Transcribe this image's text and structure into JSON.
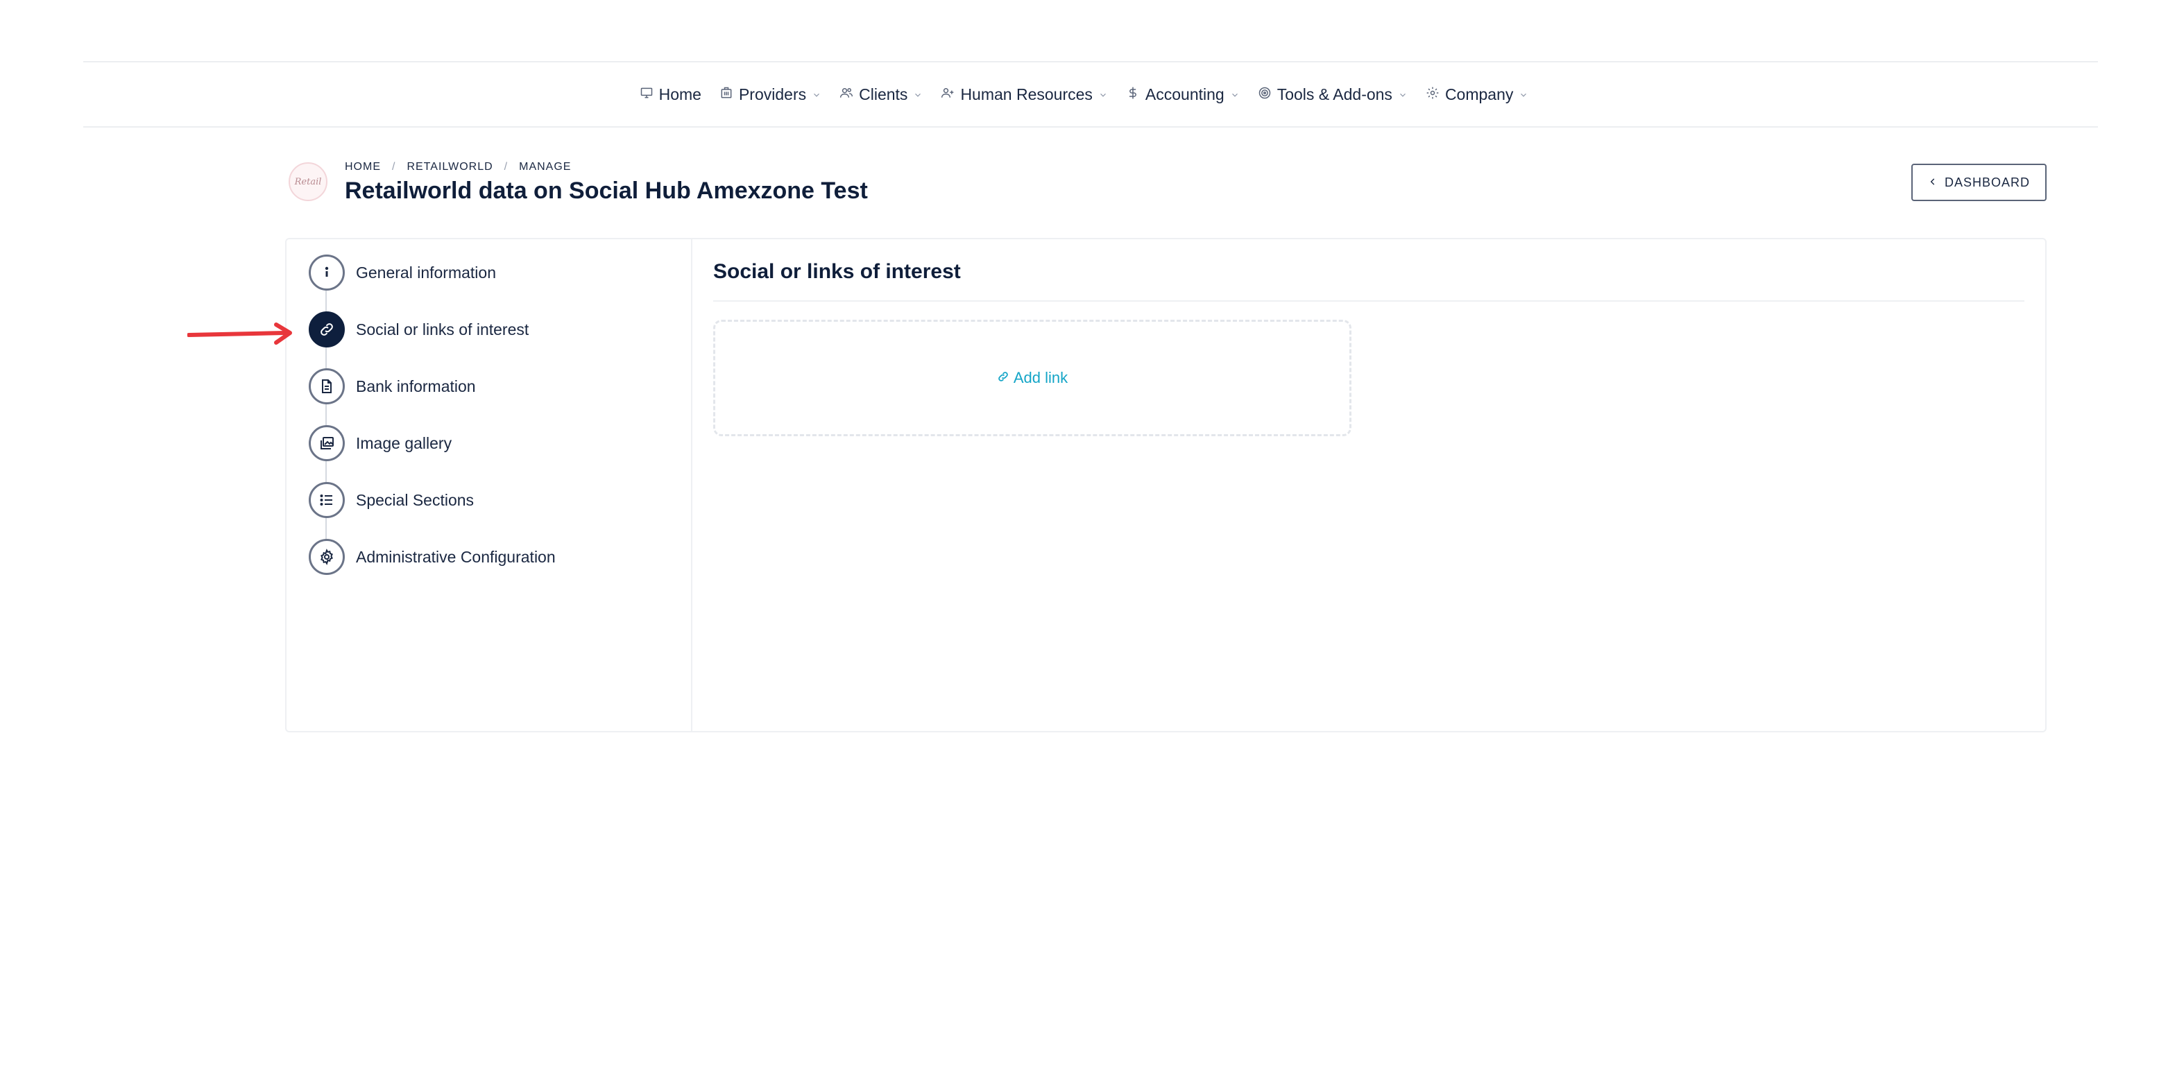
{
  "nav": {
    "items": [
      {
        "label": "Home",
        "icon": "monitor-icon",
        "dropdown": false
      },
      {
        "label": "Providers",
        "icon": "building-icon",
        "dropdown": true
      },
      {
        "label": "Clients",
        "icon": "users-icon",
        "dropdown": true
      },
      {
        "label": "Human Resources",
        "icon": "user-plus-icon",
        "dropdown": true
      },
      {
        "label": "Accounting",
        "icon": "dollar-icon",
        "dropdown": true
      },
      {
        "label": "Tools & Add-ons",
        "icon": "target-icon",
        "dropdown": true
      },
      {
        "label": "Company",
        "icon": "gear-icon",
        "dropdown": true
      }
    ]
  },
  "header": {
    "breadcrumb": [
      "HOME",
      "RETAILWORLD",
      "MANAGE"
    ],
    "title": "Retailworld data on Social Hub Amexzone Test",
    "dashboard_button": "DASHBOARD"
  },
  "sidebar": {
    "steps": [
      {
        "label": "General information",
        "icon": "info-icon",
        "active": false
      },
      {
        "label": "Social or links of interest",
        "icon": "link-icon",
        "active": true
      },
      {
        "label": "Bank information",
        "icon": "document-icon",
        "active": false
      },
      {
        "label": "Image gallery",
        "icon": "images-icon",
        "active": false
      },
      {
        "label": "Special Sections",
        "icon": "list-icon",
        "active": false
      },
      {
        "label": "Administrative Configuration",
        "icon": "gear-icon",
        "active": false
      }
    ]
  },
  "main": {
    "section_title": "Social or links of interest",
    "add_link_label": "Add link"
  },
  "colors": {
    "accent": "#14a5c7",
    "active_step": "#0e1f3d",
    "annotation_arrow": "#e8363b"
  }
}
